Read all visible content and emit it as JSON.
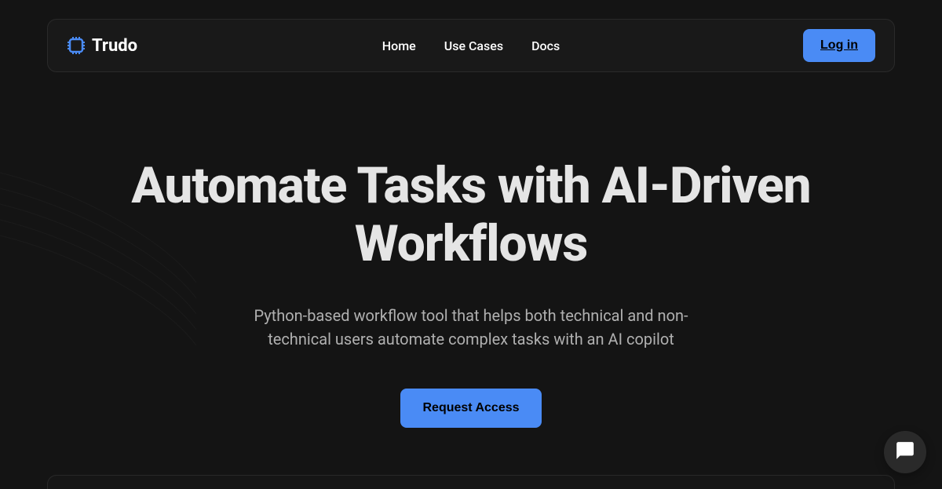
{
  "logo": {
    "text": "Trudo"
  },
  "nav": {
    "links": [
      {
        "label": "Home"
      },
      {
        "label": "Use Cases"
      },
      {
        "label": "Docs"
      }
    ],
    "login_label": "Log in"
  },
  "hero": {
    "title": "Automate Tasks with AI-Driven Workflows",
    "subtitle": "Python-based workflow tool that helps both technical and non-technical users automate complex tasks with an AI copilot",
    "cta_label": "Request Access"
  }
}
